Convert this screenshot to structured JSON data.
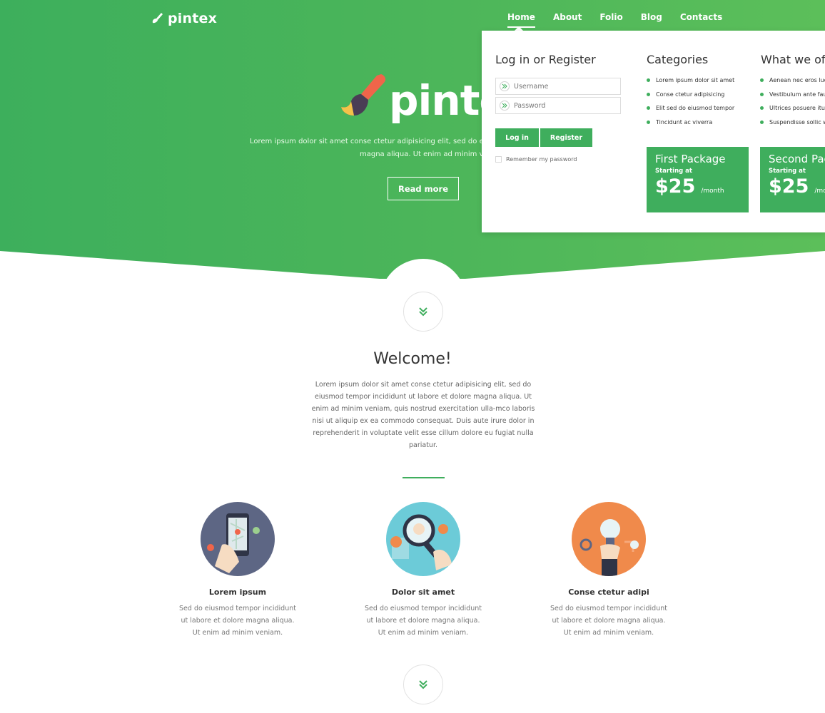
{
  "colors": {
    "accent": "#3fae5d",
    "hero_start": "#3daf5c",
    "hero_end": "#5cbf5a"
  },
  "brand": {
    "name": "pintex"
  },
  "nav": {
    "items": [
      {
        "label": "Home",
        "active": true
      },
      {
        "label": "About",
        "active": false
      },
      {
        "label": "Folio",
        "active": false
      },
      {
        "label": "Blog",
        "active": false
      },
      {
        "label": "Contacts",
        "active": false
      }
    ]
  },
  "hero": {
    "wordmark": "pintex",
    "text_line1": "Lorem ipsum dolor sit amet conse ctetur adipisicing elit, sed do eiusmod t",
    "text_line2": "magna aliqua. Ut enim ad minim venian",
    "button_label": "Read more"
  },
  "panel": {
    "login": {
      "title": "Log in or Register",
      "username_placeholder": "Username",
      "password_placeholder": "Password",
      "login_label": "Log in",
      "register_label": "Register",
      "remember_label": "Remember my password"
    },
    "categories": {
      "title": "Categories",
      "items": [
        "Lorem ipsum dolor sit amet",
        "Conse ctetur adipisicing",
        "Elit sed do eiusmod tempor",
        "Tincidunt ac viverra"
      ]
    },
    "offer": {
      "title": "What we off",
      "items": [
        "Aenean nec eros luc",
        "Vestibulum ante fau",
        "Ultrices posuere itu",
        "Suspendisse sollic wc"
      ]
    },
    "packages": [
      {
        "title": "First Package",
        "starting": "Starting at",
        "price": "$25",
        "per": "/month"
      },
      {
        "title": "Second Pac",
        "starting": "Starting at",
        "price": "$25",
        "per": "/mon"
      }
    ]
  },
  "welcome": {
    "title": "Welcome!",
    "text": "Lorem ipsum dolor sit amet conse ctetur adipisicing elit, sed do eiusmod tempor incididunt ut labore et dolore magna aliqua. Ut enim ad minim veniam, quis nostrud exercitation ulla-mco laboris nisi ut aliquip ex ea commodo consequat. Duis aute irure dolor in reprehenderit in voluptate velit esse cillum dolore eu fugiat nulla pariatur."
  },
  "features": [
    {
      "icon": "phone-map-icon",
      "title": "Lorem ipsum",
      "text": "Sed do eiusmod tempor incididunt ut labore et dolore magna aliqua. Ut enim ad minim veniam."
    },
    {
      "icon": "magnifier-icon",
      "title": "Dolor sit amet",
      "text": "Sed do eiusmod tempor incididunt ut labore et dolore magna aliqua. Ut enim ad minim veniam."
    },
    {
      "icon": "lightbulb-icon",
      "title": "Conse ctetur adipi",
      "text": "Sed do eiusmod tempor incididunt ut labore et dolore magna aliqua. Ut enim ad minim veniam."
    }
  ]
}
